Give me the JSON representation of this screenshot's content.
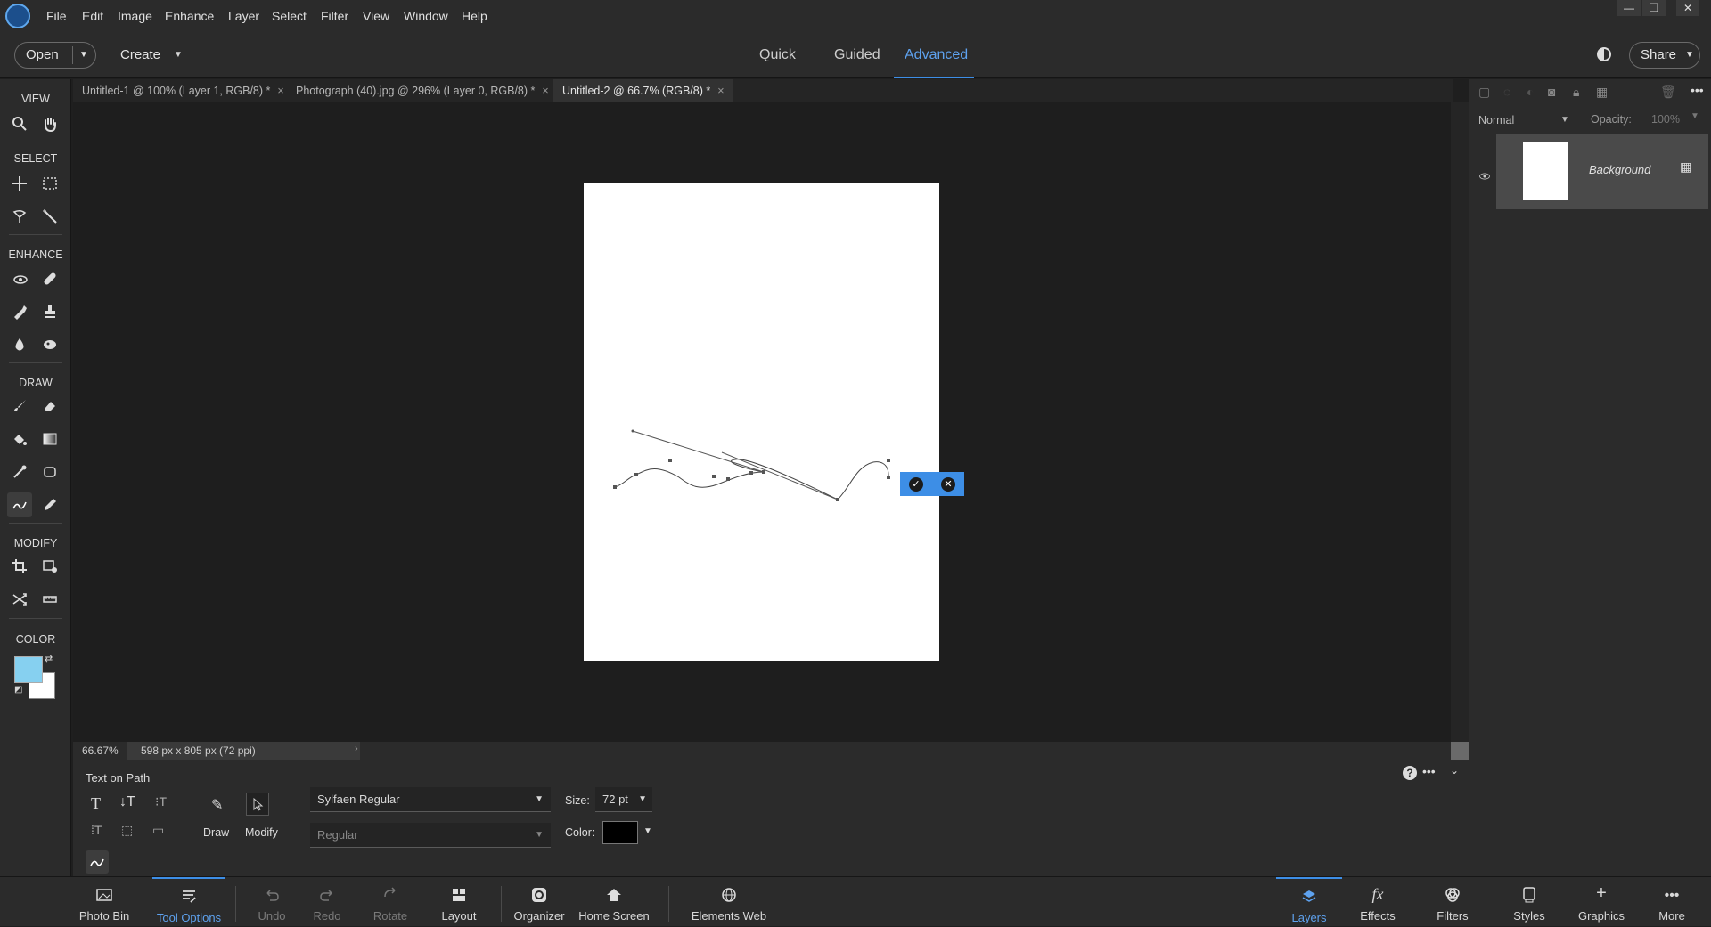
{
  "menu": {
    "items": [
      "File",
      "Edit",
      "Image",
      "Enhance",
      "Layer",
      "Select",
      "Filter",
      "View",
      "Window",
      "Help"
    ]
  },
  "window_controls": {
    "minimize": "—",
    "restore": "❐",
    "close": "✕"
  },
  "topbar": {
    "open_label": "Open",
    "create_label": "Create",
    "modes": [
      "Quick",
      "Guided",
      "Advanced"
    ],
    "active_mode": "Advanced",
    "share_label": "Share"
  },
  "doc_tabs": [
    {
      "label": "Untitled-1 @ 100% (Layer 1, RGB/8) *",
      "close": "×"
    },
    {
      "label": "Photograph (40).jpg @ 296% (Layer 0, RGB/8) *",
      "close": "×"
    },
    {
      "label": "Untitled-2 @ 66.7% (RGB/8) *",
      "close": "×",
      "active": true
    }
  ],
  "toolbox": {
    "view": "VIEW",
    "select": "SELECT",
    "enhance": "ENHANCE",
    "draw": "DRAW",
    "modify": "MODIFY",
    "color": "COLOR",
    "foreground_color": "#86d0f0",
    "background_color": "#ffffff"
  },
  "status": {
    "zoom": "66.67%",
    "doc_size": "598 px x 805 px (72 ppi)"
  },
  "tool_options": {
    "title": "Text on Path",
    "draw_label": "Draw",
    "modify_label": "Modify",
    "font_family": "Sylfaen Regular",
    "font_style": "Regular",
    "size_label": "Size:",
    "size_value": "72 pt",
    "color_label": "Color:",
    "text_color": "#000000"
  },
  "layers_panel": {
    "blend_mode": "Normal",
    "opacity_label": "Opacity:",
    "opacity_value": "100%",
    "layer_name": "Background"
  },
  "bottombar": {
    "items": [
      "Photo Bin",
      "Tool Options",
      "Undo",
      "Redo",
      "Rotate",
      "Layout",
      "Organizer",
      "Home Screen",
      "Elements Web"
    ],
    "right_items": [
      "Layers",
      "Effects",
      "Filters",
      "Styles",
      "Graphics",
      "More"
    ]
  }
}
